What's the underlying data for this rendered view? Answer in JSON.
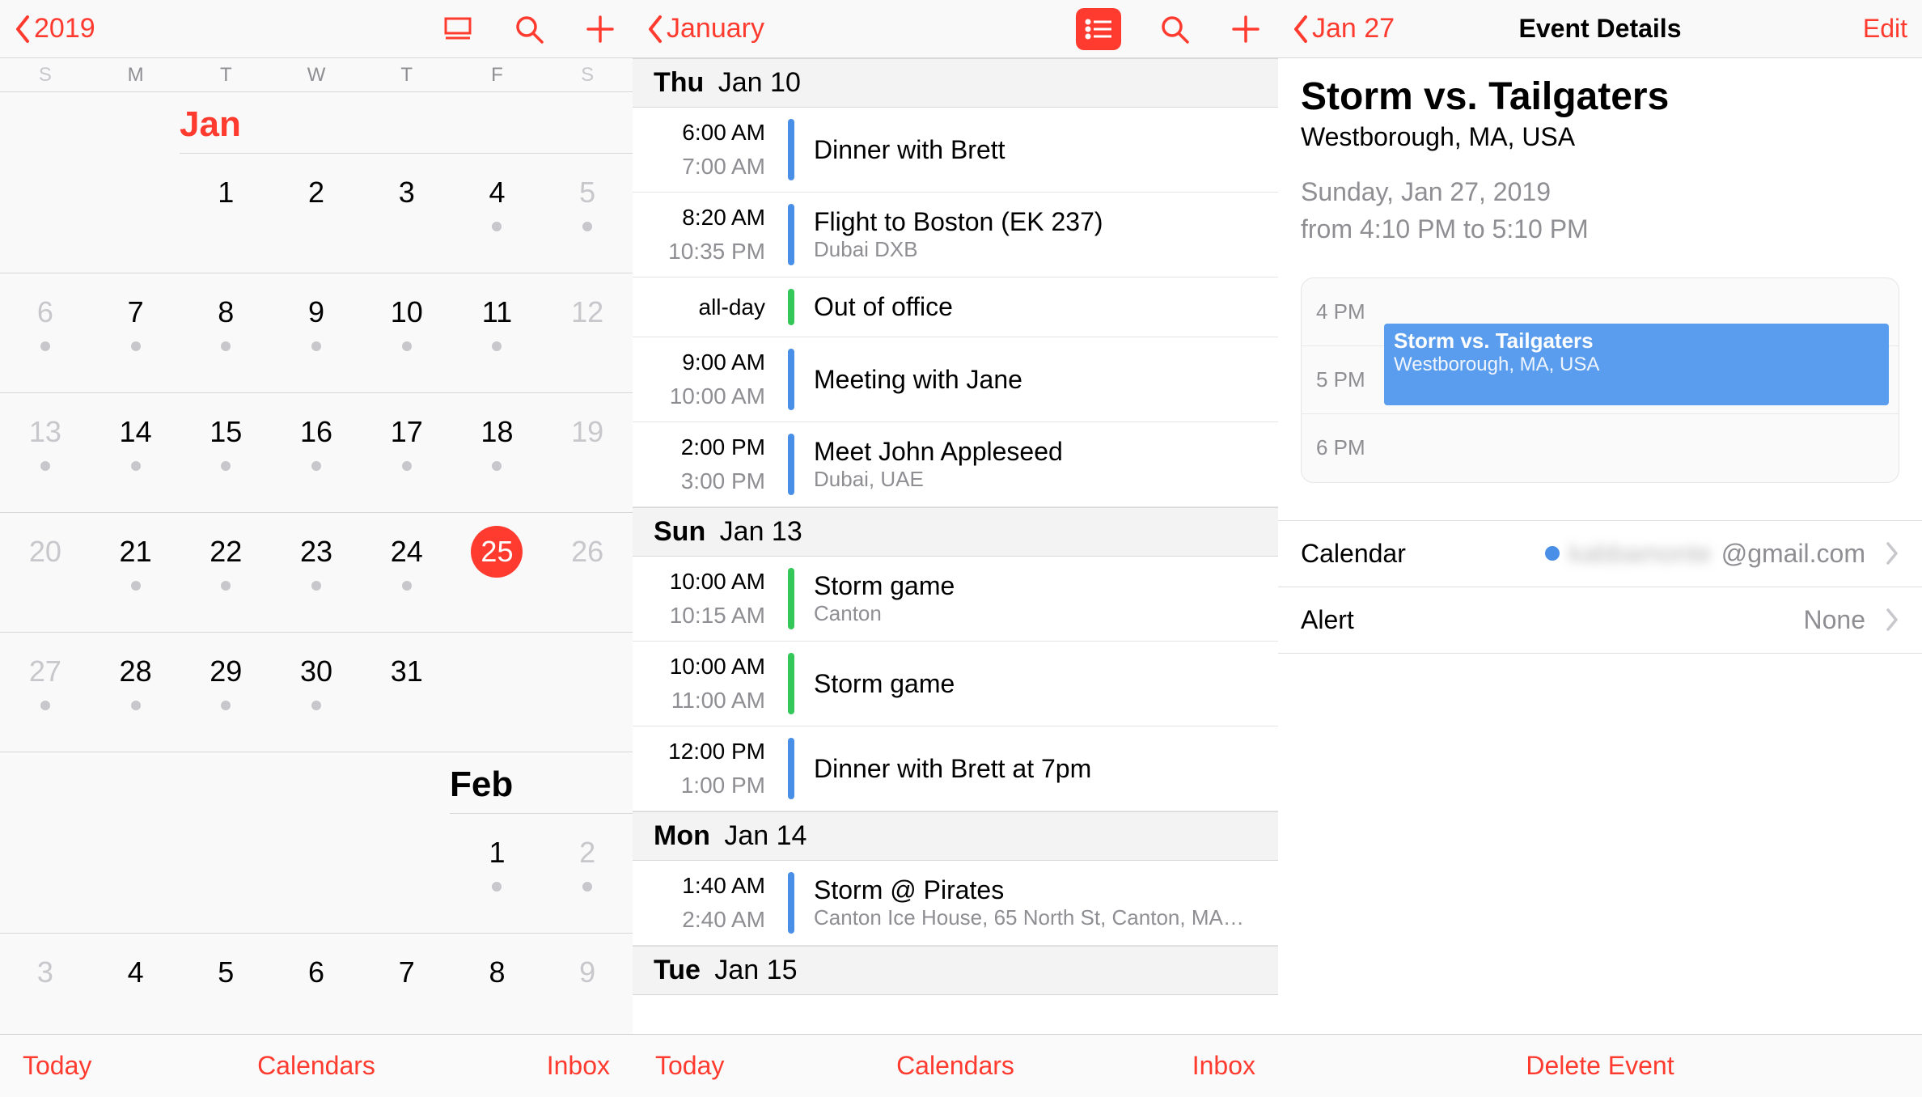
{
  "pane1": {
    "back_label": "2019",
    "weekdays": [
      "S",
      "M",
      "T",
      "W",
      "T",
      "F",
      "S"
    ],
    "months": {
      "jan_label": "Jan",
      "feb_label": "Feb"
    },
    "footer": {
      "today": "Today",
      "calendars": "Calendars",
      "inbox": "Inbox"
    },
    "grid": [
      {
        "cells": [
          {
            "n": "",
            "dot": false
          },
          {
            "n": "",
            "dot": false
          },
          {
            "n": "1",
            "dot": false
          },
          {
            "n": "2",
            "dot": false
          },
          {
            "n": "3",
            "dot": false
          },
          {
            "n": "4",
            "dot": true
          },
          {
            "n": "5",
            "dot": true,
            "outside": true
          }
        ]
      },
      {
        "cells": [
          {
            "n": "6",
            "dot": true,
            "outside": true
          },
          {
            "n": "7",
            "dot": true
          },
          {
            "n": "8",
            "dot": true
          },
          {
            "n": "9",
            "dot": true
          },
          {
            "n": "10",
            "dot": true
          },
          {
            "n": "11",
            "dot": true
          },
          {
            "n": "12",
            "dot": false,
            "outside": true
          }
        ]
      },
      {
        "cells": [
          {
            "n": "13",
            "dot": true,
            "outside": true
          },
          {
            "n": "14",
            "dot": true
          },
          {
            "n": "15",
            "dot": true
          },
          {
            "n": "16",
            "dot": true
          },
          {
            "n": "17",
            "dot": true
          },
          {
            "n": "18",
            "dot": true
          },
          {
            "n": "19",
            "dot": false,
            "outside": true
          }
        ]
      },
      {
        "cells": [
          {
            "n": "20",
            "dot": false,
            "outside": true
          },
          {
            "n": "21",
            "dot": true
          },
          {
            "n": "22",
            "dot": true
          },
          {
            "n": "23",
            "dot": true
          },
          {
            "n": "24",
            "dot": true
          },
          {
            "n": "25",
            "dot": false,
            "today": true
          },
          {
            "n": "26",
            "dot": false,
            "outside": true
          }
        ]
      },
      {
        "cells": [
          {
            "n": "27",
            "dot": true,
            "outside": true
          },
          {
            "n": "28",
            "dot": true
          },
          {
            "n": "29",
            "dot": true
          },
          {
            "n": "30",
            "dot": true
          },
          {
            "n": "31",
            "dot": false
          },
          {
            "n": "",
            "dot": false
          },
          {
            "n": "",
            "dot": false
          }
        ]
      }
    ],
    "feb_grid": [
      {
        "cells": [
          {
            "n": "",
            "dot": false
          },
          {
            "n": "",
            "dot": false
          },
          {
            "n": "",
            "dot": false
          },
          {
            "n": "",
            "dot": false
          },
          {
            "n": "",
            "dot": false
          },
          {
            "n": "1",
            "dot": true
          },
          {
            "n": "2",
            "dot": true,
            "outside": true
          }
        ]
      },
      {
        "cells": [
          {
            "n": "3",
            "outside": true
          },
          {
            "n": "4"
          },
          {
            "n": "5"
          },
          {
            "n": "6"
          },
          {
            "n": "7"
          },
          {
            "n": "8"
          },
          {
            "n": "9",
            "outside": true
          }
        ]
      }
    ]
  },
  "pane2": {
    "back_label": "January",
    "footer": {
      "today": "Today",
      "calendars": "Calendars",
      "inbox": "Inbox"
    },
    "sections": [
      {
        "dow": "Thu",
        "date": "Jan 10",
        "events": [
          {
            "t1": "6:00 AM",
            "t2": "7:00 AM",
            "color": "blue",
            "title": "Dinner with Brett",
            "sub": ""
          },
          {
            "t1": "8:20 AM",
            "t2": "10:35 PM",
            "color": "blue",
            "title": "Flight to Boston (EK 237)",
            "sub": "Dubai DXB"
          },
          {
            "t1": "all-day",
            "t2": "",
            "color": "green",
            "title": "Out of office",
            "sub": ""
          },
          {
            "t1": "9:00 AM",
            "t2": "10:00 AM",
            "color": "blue",
            "title": "Meeting with Jane",
            "sub": ""
          },
          {
            "t1": "2:00 PM",
            "t2": "3:00 PM",
            "color": "blue",
            "title": "Meet John Appleseed",
            "sub": "Dubai, UAE"
          }
        ]
      },
      {
        "dow": "Sun",
        "date": "Jan 13",
        "events": [
          {
            "t1": "10:00 AM",
            "t2": "10:15 AM",
            "color": "green",
            "title": "Storm game",
            "sub": "Canton"
          },
          {
            "t1": "10:00 AM",
            "t2": "11:00 AM",
            "color": "green",
            "title": "Storm game",
            "sub": ""
          },
          {
            "t1": "12:00 PM",
            "t2": "1:00 PM",
            "color": "blue",
            "title": "Dinner with Brett at 7pm",
            "sub": ""
          }
        ]
      },
      {
        "dow": "Mon",
        "date": "Jan 14",
        "events": [
          {
            "t1": "1:40 AM",
            "t2": "2:40 AM",
            "color": "blue",
            "title": "Storm @ Pirates",
            "sub": "Canton Ice House, 65 North St, Canton, MA…"
          }
        ]
      },
      {
        "dow": "Tue",
        "date": "Jan 15",
        "events": []
      }
    ]
  },
  "pane3": {
    "back_label": "Jan 27",
    "page_title": "Event Details",
    "edit": "Edit",
    "event_title": "Storm vs. Tailgaters",
    "event_loc": "Westborough, MA, USA",
    "event_date": "Sunday, Jan 27, 2019",
    "event_time": "from 4:10 PM to 5:10 PM",
    "mini": {
      "slots": [
        "4 PM",
        "5 PM",
        "6 PM"
      ],
      "chip_title": "Storm vs. Tailgaters",
      "chip_sub": "Westborough, MA, USA"
    },
    "calendar_row": {
      "label": "Calendar",
      "account_blur": "kabbamonte",
      "account_domain": "@gmail.com"
    },
    "alert_row": {
      "label": "Alert",
      "value": "None"
    },
    "delete": "Delete Event"
  }
}
